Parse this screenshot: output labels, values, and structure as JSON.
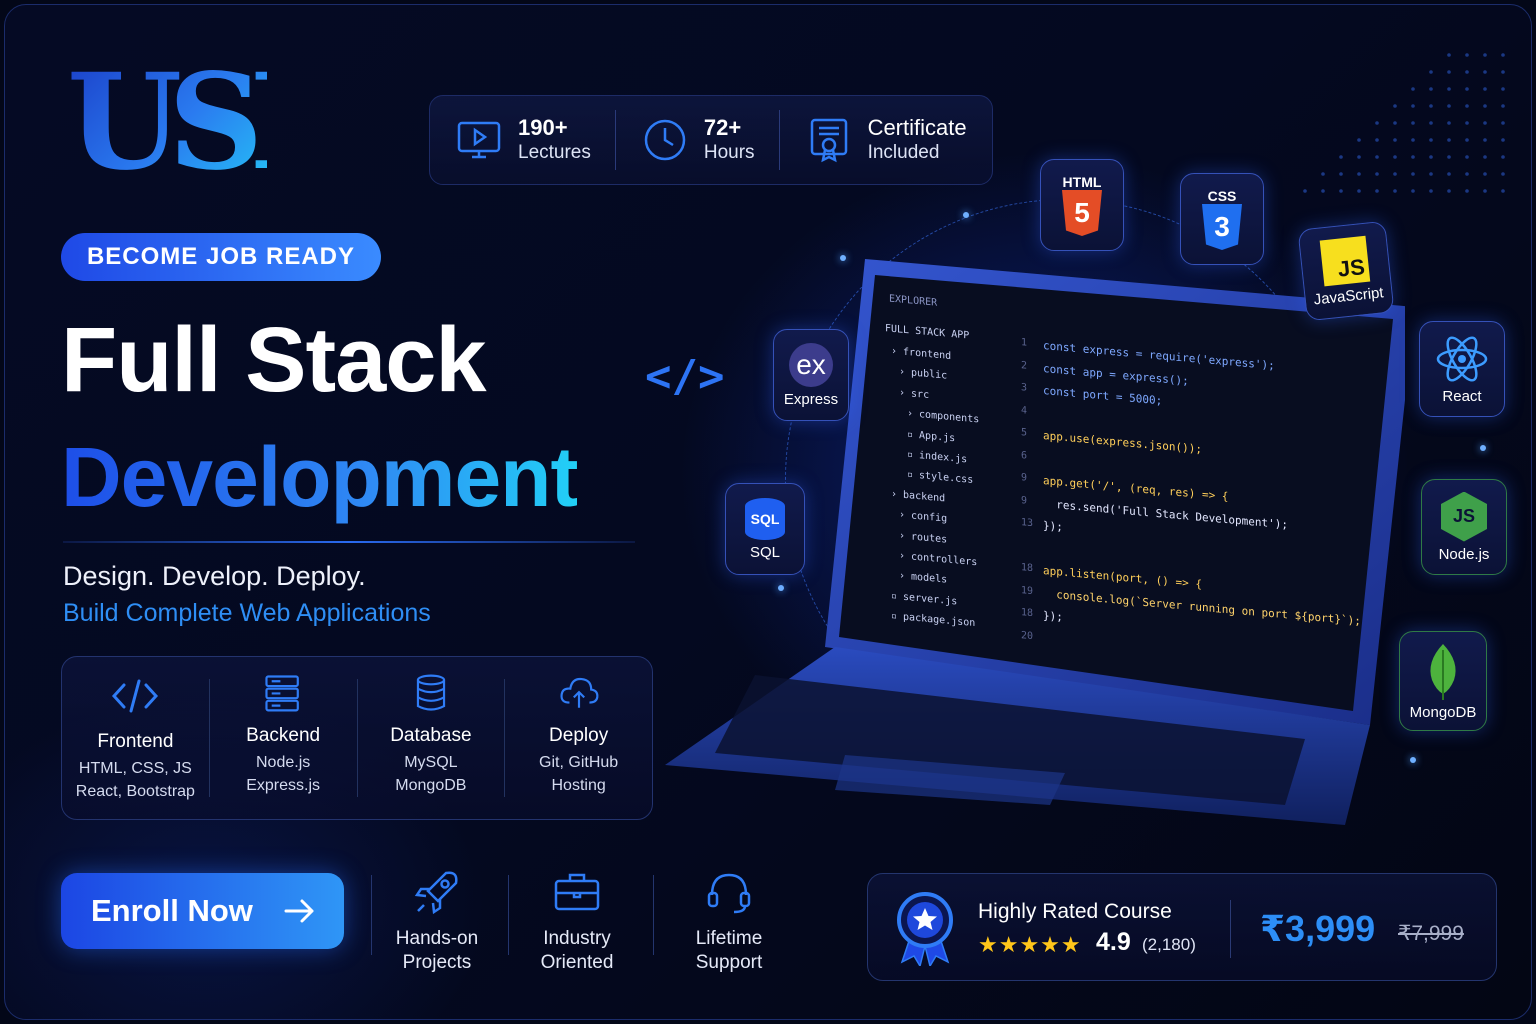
{
  "brand": {
    "logo_text": "USH"
  },
  "stats": [
    {
      "icon": "video-lecture-icon",
      "value": "190+",
      "label": "Lectures"
    },
    {
      "icon": "clock-icon",
      "value": "72+",
      "label": "Hours"
    },
    {
      "icon": "certificate-icon",
      "value": "Certificate",
      "label": "Included"
    }
  ],
  "badge": "BECOME JOB READY",
  "title": {
    "line1": "Full Stack",
    "line2": "Development",
    "code_tag": "</>"
  },
  "tagline": "Design. Develop. Deploy.",
  "subtagline": "Build Complete Web Applications",
  "stack": [
    {
      "icon": "code-icon",
      "title": "Frontend",
      "line1": "HTML, CSS, JS",
      "line2": "React, Bootstrap"
    },
    {
      "icon": "server-icon",
      "title": "Backend",
      "line1": "Node.js",
      "line2": "Express.js"
    },
    {
      "icon": "database-icon",
      "title": "Database",
      "line1": "MySQL",
      "line2": "MongoDB"
    },
    {
      "icon": "cloud-upload-icon",
      "title": "Deploy",
      "line1": "Git, GitHub",
      "line2": "Hosting"
    }
  ],
  "cta": {
    "label": "Enroll Now"
  },
  "features": [
    {
      "icon": "rocket-icon",
      "line1": "Hands-on",
      "line2": "Projects"
    },
    {
      "icon": "briefcase-icon",
      "line1": "Industry",
      "line2": "Oriented"
    },
    {
      "icon": "headset-icon",
      "line1": "Lifetime",
      "line2": "Support"
    }
  ],
  "rating": {
    "label": "Highly Rated Course",
    "stars": "★★★★★",
    "score": "4.9",
    "count": "(2,180)",
    "price": "₹3,999",
    "old_price": "₹7,999"
  },
  "tech_tiles": {
    "html": {
      "badge": "HTML",
      "glyph": "5"
    },
    "css": {
      "badge": "CSS",
      "glyph": "3"
    },
    "js": {
      "glyph": "JS",
      "label": "JavaScript"
    },
    "express": {
      "glyph": "ex",
      "label": "Express"
    },
    "sql": {
      "glyph": "SQL",
      "label": "SQL"
    },
    "react": {
      "label": "React"
    },
    "node": {
      "glyph": "JS",
      "label": "Node.js"
    },
    "mongo": {
      "label": "MongoDB"
    }
  },
  "editor": {
    "explorer_title": "EXPLORER",
    "project": "FULL STACK APP",
    "tree": [
      "frontend",
      "public",
      "src",
      "components",
      "App.js",
      "index.js",
      "style.css",
      "backend",
      "config",
      "routes",
      "controllers",
      "models",
      "server.js",
      "package.json"
    ],
    "line_numbers": [
      "1",
      "2",
      "3",
      "4",
      "5",
      "6",
      "9",
      "9",
      "13",
      "",
      "18",
      "19",
      "18",
      "20"
    ],
    "code_lines": [
      "const express = require('express');",
      "const app = express();",
      "const port = 5000;",
      "",
      "app.use(express.json());",
      "",
      "app.get('/', (req, res) => {",
      "  res.send('Full Stack Development');",
      "});",
      "",
      "app.listen(port, () => {",
      "  console.log(`Server running on port ${port}`);",
      "});",
      ""
    ]
  },
  "colors": {
    "accent": "#2d8ef6",
    "brand_blue": "#1f49e6",
    "star": "#ffc61a",
    "bg": "#040920"
  }
}
